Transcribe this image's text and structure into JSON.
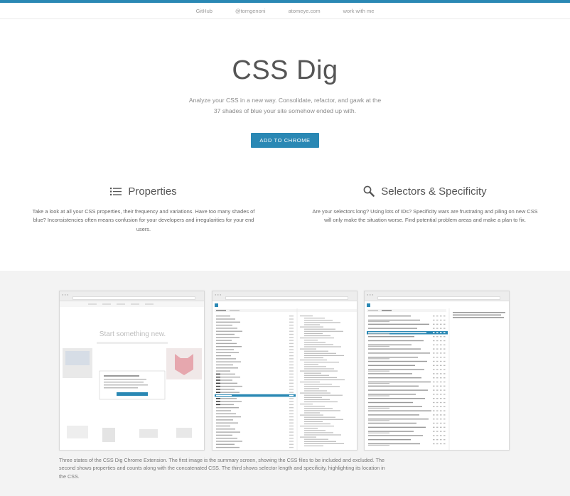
{
  "nav": {
    "items": [
      "GitHub",
      "@tomgenoni",
      "atomeye.com",
      "work with me"
    ]
  },
  "hero": {
    "title": "CSS Dig",
    "subtitle": "Analyze your CSS in a new way. Consolidate, refactor, and gawk at the 37 shades of blue your site somehow ended up with.",
    "cta": "ADD TO CHROME"
  },
  "features": {
    "properties": {
      "icon": "list-icon",
      "title": "Properties",
      "description": "Take a look at all your CSS properties, their frequency and variations. Have too many shades of blue? Inconsistencies often means confusion for your developers and irregularities for your end users."
    },
    "selectors": {
      "icon": "magnifier-icon",
      "title": "Selectors & Specificity",
      "description": "Are your selectors long? Using lots of IDs? Specificity wars are frustrating and piling on new CSS will only make the situation worse. Find potential problem areas and make a plan to fix."
    }
  },
  "screenshots": {
    "shot1_heading": "Start something new.",
    "caption": "Three states of the CSS Dig Chrome Extension. The first image is the summary screen, showing the CSS files to be included and excluded. The second shows properties and counts along with the concatenated CSS. The third shows selector length and specificity, highlighting its location in the CSS."
  },
  "colors": {
    "accent": "#2a88b4",
    "band": "#f3f3f3"
  }
}
